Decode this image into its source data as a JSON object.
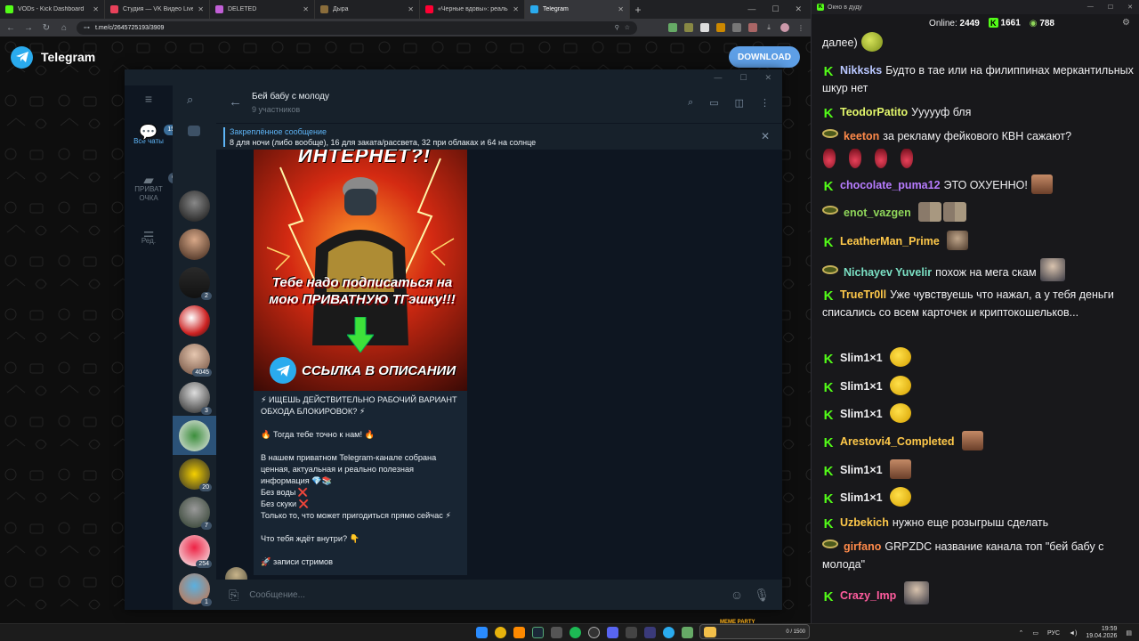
{
  "browser": {
    "tabs": [
      {
        "label": "VODs - Kick Dashboard",
        "color": "#53fc18"
      },
      {
        "label": "Студия — VK Видео Live",
        "color": "#e8415a"
      },
      {
        "label": "DELETED",
        "color": "#c15fd6"
      },
      {
        "label": "Дыра",
        "color": "#8a6d3b"
      },
      {
        "label": "«Черные вдовы»: реальность",
        "color": "#ff0033"
      },
      {
        "label": "Telegram",
        "color": "#2aabee"
      }
    ],
    "active_tab_index": 5,
    "address": "t.me/c/2645725193/3909"
  },
  "telegram_web": {
    "brand": "Telegram",
    "download_label": "DOWNLOAD"
  },
  "tg_app": {
    "rail": {
      "all_chats": {
        "label": "Все чаты",
        "badge": "15"
      },
      "private": {
        "label": "ПРИВАТ ОЧКА",
        "badge": "6"
      },
      "edit": {
        "label": "Ред."
      }
    },
    "chat_badges": [
      "",
      "",
      "",
      "2",
      "",
      "4045",
      "3",
      "",
      "20",
      "7",
      "254",
      "1"
    ],
    "chat": {
      "title": "Бей бабу с молоду",
      "subtitle": "9 участников",
      "pinned_title": "Закреплённое сообщение",
      "pinned_text": "8 для ночи (либо вообще), 16 для заката/рассвета, 32 при облаках и 64 на солнце",
      "image_top_text": "ИНТЕРНЕТ?!",
      "image_promo_text": "Тебе надо подписаться на мою ПРИВАТНУЮ ТГэшку!!!",
      "image_bottom_text": "ССЫЛКА В ОПИСАНИИ",
      "message_text": "⚡ ИЩЕШЬ ДЕЙСТВИТЕЛЬНО РАБОЧИЙ ВАРИАНТ ОБХОДА БЛОКИРОВОК? ⚡\n\n🔥 Тогда тебе точно к нам! 🔥\n\nВ нашем приватном Telegram-канале собрана ценная, актуальная и реально полезная информация 💎📚\nБез воды ❌\nБез скуки ❌\nТолько то, что может пригодиться прямо сейчас ⚡\n\nЧто тебя ждёт внутри? 👇\n\n🚀 записи стримов",
      "composer_placeholder": "Сообщение..."
    }
  },
  "stream_chat": {
    "window_title": "Окно в дуду",
    "online_label": "Online:",
    "online_count": "2449",
    "followers": "1661",
    "subs": "788",
    "messages": [
      {
        "badge": "",
        "user": "",
        "color": "#efeff1",
        "text": "далее)",
        "emotes": [
          "pepe"
        ]
      },
      {
        "badge": "k",
        "user": "Nikksks",
        "color": "#b9c7ff",
        "text": "Будто в тае или на филиппинах меркантильных шкур нет",
        "emotes": []
      },
      {
        "badge": "k",
        "user": "TeodorPatito",
        "color": "#e2f66b",
        "text": "Уууууф бля",
        "emotes": []
      },
      {
        "badge": "sub",
        "user": "keeton",
        "color": "#ff8a4a",
        "text": "за рекламу фейкового КВН сажают?",
        "emotes": [
          "drop",
          "drop",
          "drop",
          "drop"
        ]
      },
      {
        "badge": "k",
        "user": "chocolate_puma12",
        "color": "#b77cff",
        "text": "ЭТО ОХУЕННО!",
        "emotes": [
          "face"
        ]
      },
      {
        "badge": "sub",
        "user": "enot_vazgen",
        "color": "#8fd65a",
        "text": "",
        "emotes": [
          "duo",
          "duo"
        ]
      },
      {
        "badge": "k",
        "user": "LeatherMan_Prime",
        "color": "#ffc94a",
        "text": "",
        "emotes": [
          "man"
        ]
      },
      {
        "badge": "sub",
        "user": "Nichayev Yuvelir",
        "color": "#7be0c4",
        "text": "похож на мега скам",
        "emotes": [
          "bald"
        ]
      },
      {
        "badge": "k",
        "user": "TrueTr0ll",
        "color": "#ffc94a",
        "text": "Уже чувствуешь что нажал, а у тебя деньги списались со всем карточек и криптокошельков...",
        "emotes": []
      },
      {
        "badge": "k",
        "user": "Slim1×1",
        "color": "#efeff1",
        "text": "",
        "emotes": [
          "lol"
        ]
      },
      {
        "badge": "k",
        "user": "Slim1×1",
        "color": "#efeff1",
        "text": "",
        "emotes": [
          "lol"
        ]
      },
      {
        "badge": "k",
        "user": "Slim1×1",
        "color": "#efeff1",
        "text": "",
        "emotes": [
          "lol"
        ]
      },
      {
        "badge": "k",
        "user": "Arestovi4_Completed",
        "color": "#ffc94a",
        "text": "",
        "emotes": [
          "face"
        ]
      },
      {
        "badge": "k",
        "user": "Slim1×1",
        "color": "#efeff1",
        "text": "",
        "emotes": [
          "face"
        ]
      },
      {
        "badge": "k",
        "user": "Slim1×1",
        "color": "#efeff1",
        "text": "",
        "emotes": [
          "lol"
        ]
      },
      {
        "badge": "k",
        "user": "Uzbekich",
        "color": "#ffc94a",
        "text": "нужно еще розыгрыш сделать",
        "emotes": []
      },
      {
        "badge": "sub",
        "user": "girfano",
        "color": "#ff8a4a",
        "text": "GRPZDC название канала топ \"бей бабу с молода\"",
        "emotes": []
      },
      {
        "badge": "k",
        "user": "Crazy_Imp",
        "color": "#ff5c9e",
        "text": "",
        "emotes": [
          "bald"
        ]
      }
    ]
  },
  "taskbar": {
    "party_title": "MEME PARTY",
    "party_progress": "0 / 1500",
    "lang": "РУС",
    "time": "19:59",
    "date": "19.04.2026"
  }
}
